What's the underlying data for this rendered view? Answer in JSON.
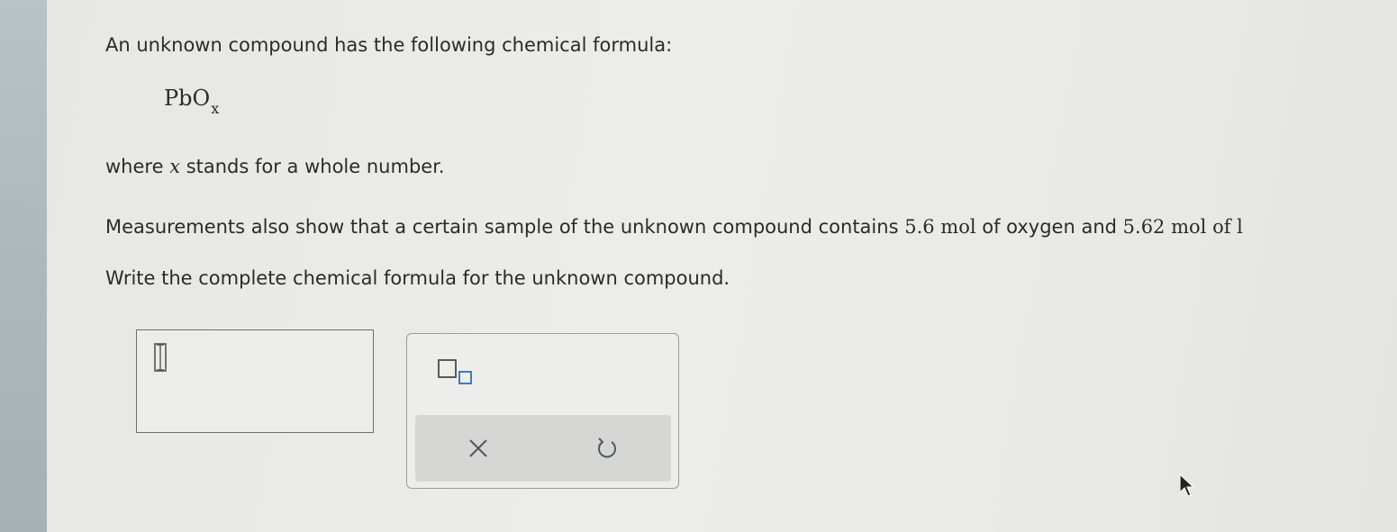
{
  "question": {
    "intro": "An unknown compound has the following chemical formula:",
    "formula": {
      "base": "PbO",
      "subscript": "x"
    },
    "where": {
      "prefix": "where ",
      "variable": "x",
      "suffix": " stands for a whole number."
    },
    "measurement": {
      "prefix": "Measurements also show that a certain sample of the unknown compound contains ",
      "oxygen_amount": "5.6",
      "unit_mol": "mol",
      "middle": " of oxygen and ",
      "lead_amount": "5.62",
      "unit_mol_2": "mol",
      "suffix": " of l"
    },
    "prompt": "Write the complete chemical formula for the unknown compound."
  },
  "answer": {
    "value": ""
  },
  "toolbar": {
    "icons": {
      "subscript": "subscript-template-icon",
      "clear": "close-icon",
      "undo": "undo-icon"
    }
  }
}
